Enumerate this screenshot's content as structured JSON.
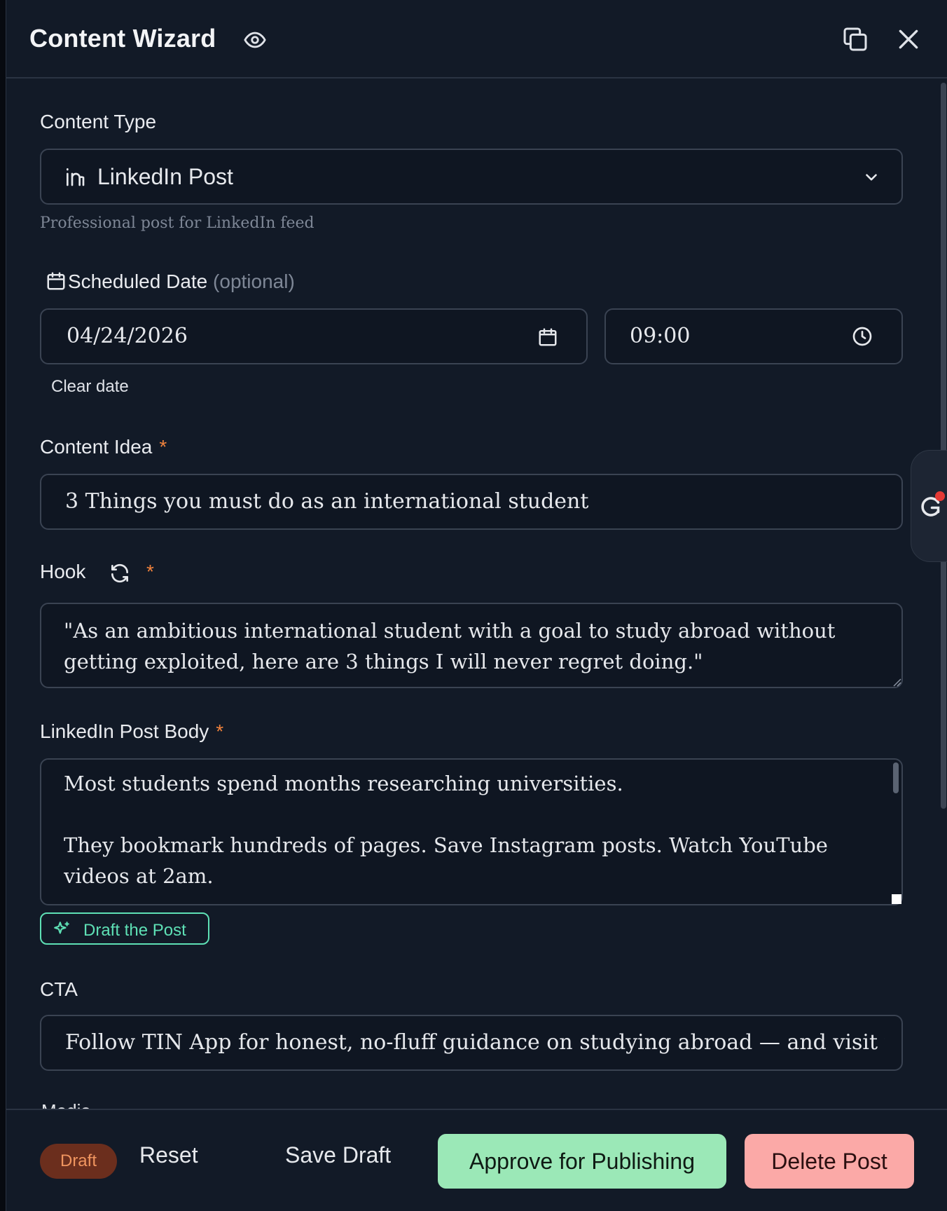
{
  "header": {
    "title": "Content Wizard"
  },
  "content_type": {
    "label": "Content Type",
    "selected": "LinkedIn Post",
    "helper": "Professional post for LinkedIn feed"
  },
  "schedule": {
    "label": "Scheduled Date",
    "optional": "(optional)",
    "date": "04/24/2026",
    "time": "09:00",
    "clear_label": "Clear date"
  },
  "idea": {
    "label": "Content Idea",
    "required_mark": "*",
    "value": "3 Things you must do as an international student"
  },
  "hook": {
    "label": "Hook",
    "required_mark": "*",
    "value": "\"As an ambitious international student with a goal to study abroad without getting exploited, here are 3 things I will never regret doing.\""
  },
  "body": {
    "label": "LinkedIn Post Body",
    "required_mark": "*",
    "value": "Most students spend months researching universities.\n\nThey bookmark hundreds of pages. Save Instagram posts. Watch YouTube videos at 2am."
  },
  "draft_button": {
    "label": "Draft the Post"
  },
  "cta": {
    "label": "CTA",
    "value": "Follow TIN App for honest, no-fluff guidance on studying abroad — and visit w"
  },
  "media": {
    "label": "Media"
  },
  "footer": {
    "status": "Draft",
    "reset": "Reset",
    "save_draft": "Save Draft",
    "approve": "Approve for Publishing",
    "delete": "Delete Post"
  },
  "colors": {
    "panel_bg": "#121a27",
    "accent_green": "#5ee0b5",
    "approve_bg": "#9be8b7",
    "delete_bg": "#fba9a7",
    "required": "#f0823c",
    "status_bg": "#6b2e1d"
  }
}
